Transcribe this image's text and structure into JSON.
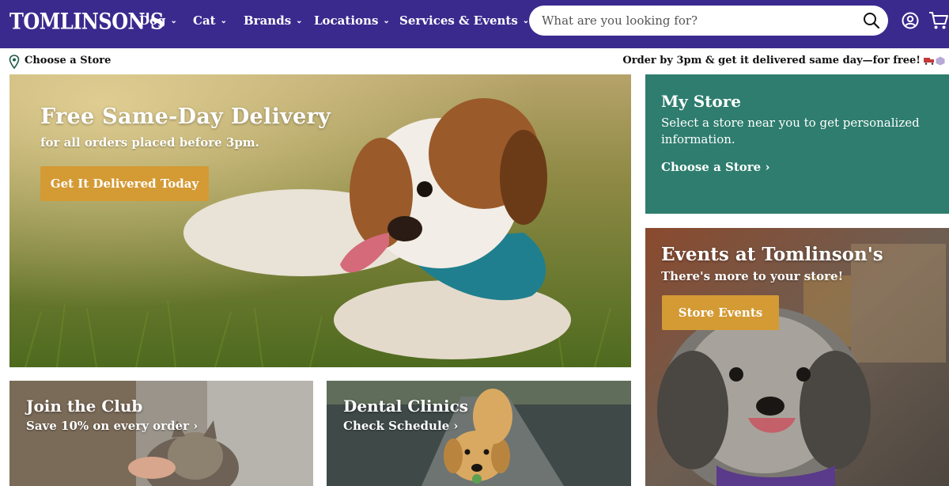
{
  "header": {
    "logo_text": "TOMLINSON'S",
    "nav": [
      {
        "label": "Dog"
      },
      {
        "label": "Cat"
      },
      {
        "label": "Brands"
      },
      {
        "label": "Locations"
      },
      {
        "label": "Services & Events"
      }
    ],
    "search": {
      "placeholder": "What are you looking for?"
    },
    "icons": {
      "search": "search-icon",
      "account": "account-icon",
      "cart": "cart-icon"
    }
  },
  "utility": {
    "store_link": "Choose a Store",
    "promo": "Order by 3pm & get it delivered same day—for free!"
  },
  "hero": {
    "title": "Free Same-Day Delivery",
    "subtitle": "for all orders placed before 3pm.",
    "button": "Get It Delivered Today"
  },
  "my_store": {
    "title": "My Store",
    "text": "Select a store near you to get personalized information.",
    "link": "Choose a Store ›"
  },
  "events": {
    "title": "Events at Tomlinson's",
    "subtitle": "There's more to your store!",
    "button": "Store Events"
  },
  "club": {
    "title": "Join the Club",
    "subtitle": "Save 10% on every order ›"
  },
  "dental": {
    "title": "Dental Clinics",
    "subtitle": "Check Schedule ›"
  },
  "colors": {
    "header_bg": "#3a2a8e",
    "accent_button": "#d49a34",
    "my_store_bg": "#2e7d6e"
  }
}
